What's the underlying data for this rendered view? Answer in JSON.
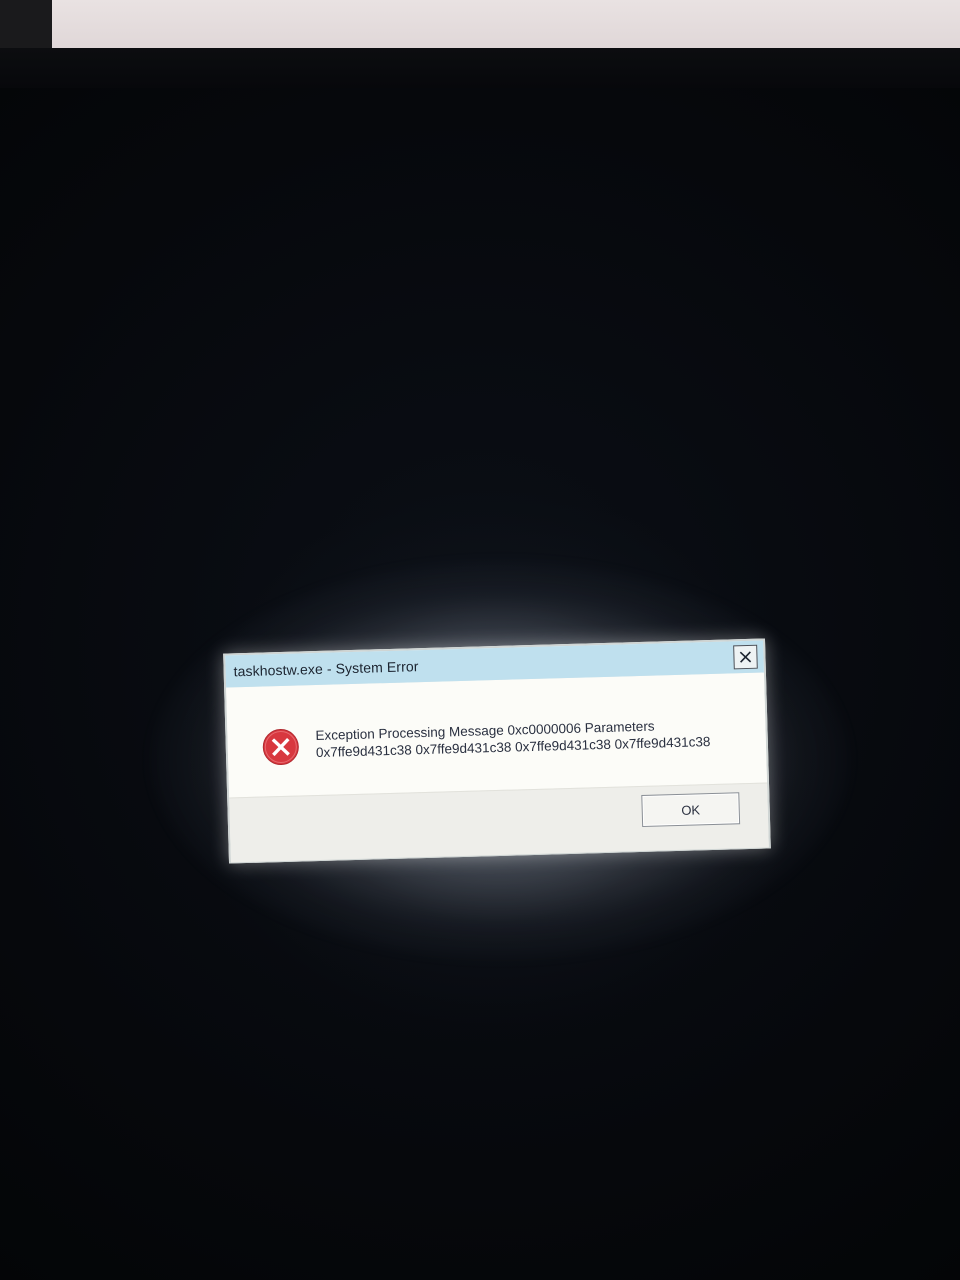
{
  "dialog": {
    "title": "taskhostw.exe - System Error",
    "message_line1": "Exception Processing Message 0xc0000006 Parameters",
    "message_line2": "0x7ffe9d431c38 0x7ffe9d431c38 0x7ffe9d431c38 0x7ffe9d431c38",
    "ok_label": "OK",
    "icon": "error-icon",
    "close_icon": "close-icon"
  },
  "colors": {
    "titlebar": "#bfe0ee",
    "error_red": "#d8383f",
    "background": "#05070a"
  }
}
